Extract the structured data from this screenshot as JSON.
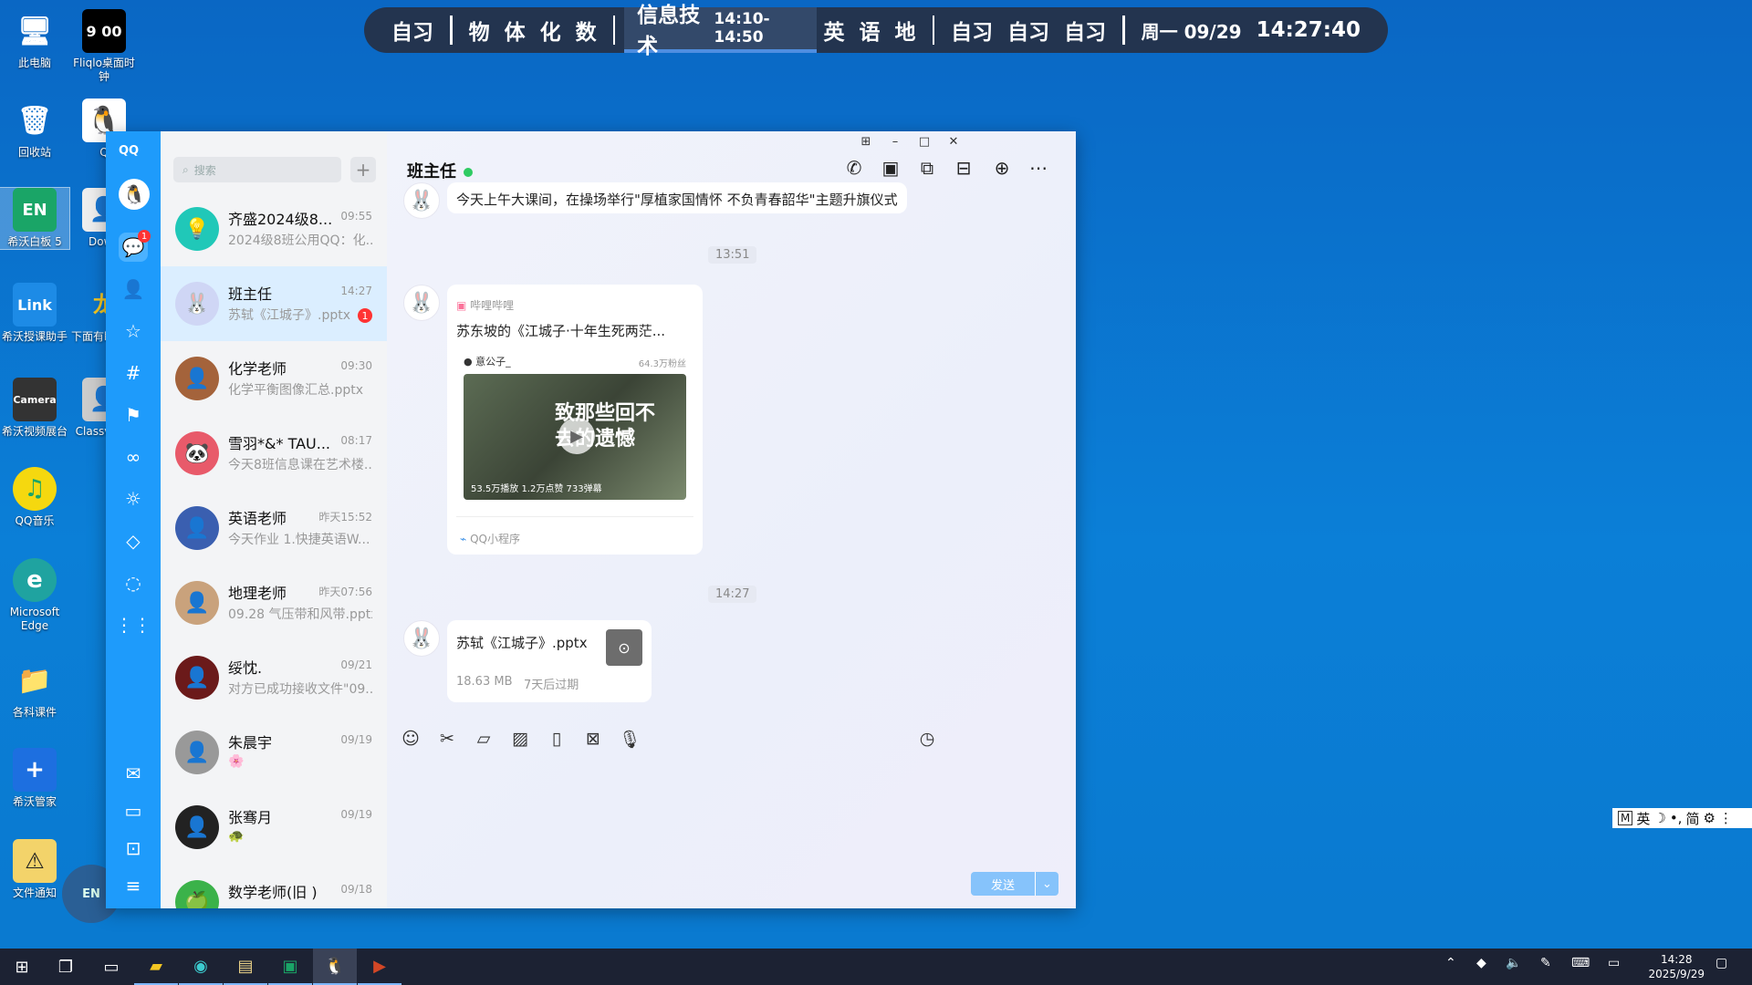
{
  "desktop": {
    "icons": [
      {
        "label": "此电脑",
        "glyph": "🖥"
      },
      {
        "label": "Fliqlo桌面时钟",
        "glyph": "9 00"
      },
      {
        "label": "回收站",
        "glyph": "🗑"
      },
      {
        "label": "Q",
        "glyph": "🐧"
      },
      {
        "label": "希沃白板 5",
        "glyph": "EN"
      },
      {
        "label": "Down",
        "glyph": "👤"
      },
      {
        "label": "希沃授课助手",
        "glyph": "Link"
      },
      {
        "label": "下面有盯着你",
        "glyph": "龙"
      },
      {
        "label": "希沃视频展台",
        "glyph": "Camera"
      },
      {
        "label": "Classv作业",
        "glyph": "👤"
      },
      {
        "label": "QQ音乐",
        "glyph": "♫"
      },
      {
        "label": "Microsoft Edge",
        "glyph": "e"
      },
      {
        "label": "各科课件",
        "glyph": "📁"
      },
      {
        "label": "希沃管家",
        "glyph": "+"
      },
      {
        "label": "文件通知",
        "glyph": "⚠"
      }
    ]
  },
  "schedule": {
    "items": [
      "自习",
      "物",
      "体",
      "化",
      "数",
      "英",
      "语",
      "地",
      "自习",
      "自习",
      "自习"
    ],
    "current": "信息技术",
    "current_time": "14:10-14:50",
    "date": "周一 09/29",
    "clock": "14:27:40"
  },
  "qq": {
    "logo": "QQ",
    "rail_badge": "1",
    "search_placeholder": "搜索",
    "conversations": [
      {
        "name": "齐盛2024级8...",
        "time": "09:55",
        "preview": "2024级8班公用QQ：化...",
        "color": "#20c8b8",
        "glyph": "💡"
      },
      {
        "name": "班主任",
        "time": "14:27",
        "preview": "苏轼《江城子》.pptx",
        "unread": "1",
        "color": "#cfd6f5",
        "glyph": "🐰"
      },
      {
        "name": "化学老师",
        "time": "09:30",
        "preview": "化学平衡图像汇总.pptx",
        "color": "#a4633b",
        "glyph": "👤"
      },
      {
        "name": "雪羽*&* TAU...",
        "time": "08:17",
        "preview": "今天8班信息课在艺术楼...",
        "color": "#e85a6a",
        "glyph": "🐼"
      },
      {
        "name": "英语老师",
        "time": "昨天15:52",
        "preview": "今天作业 1.快捷英语W...",
        "color": "#3a5fb0",
        "glyph": "👤"
      },
      {
        "name": "地理老师",
        "time": "昨天07:56",
        "preview": "09.28 气压带和风带.pptx",
        "color": "#c9a27c",
        "glyph": "👤"
      },
      {
        "name": "绥忱.",
        "time": "09/21",
        "preview": "对方已成功接收文件\"09...",
        "color": "#6b1a1a",
        "glyph": "👤"
      },
      {
        "name": "朱晨宇",
        "time": "09/19",
        "preview": "🌸",
        "color": "#999",
        "glyph": "👤"
      },
      {
        "name": "张骞月",
        "time": "09/19",
        "preview": "🐢",
        "color": "#222",
        "glyph": "👤"
      },
      {
        "name": "数学老师(旧 )",
        "time": "09/18",
        "preview": "",
        "color": "#3bb24a",
        "glyph": "🍏"
      }
    ],
    "chat": {
      "title": "班主任",
      "msg1": "今天上午大课间，在操场举行\"厚植家国情怀 不负青春韶华\"主题升旗仪式",
      "stamp1": "13:51",
      "card_source": "哔哩哔哩",
      "card_title": "苏东坡的《江城子·十年生死两茫...",
      "card_uploader": "意公子_",
      "card_fans": "64.3万粉丝",
      "card_stats": "53.5万播放  1.2万点赞  733弹幕",
      "card_overlay": "致那些回不去的遗憾",
      "card_app": "QQ小程序",
      "stamp2": "14:27",
      "file_name": "苏轼《江城子》.pptx",
      "file_size": "18.63 MB",
      "file_expire": "7天后过期",
      "send": "发送"
    }
  },
  "ime": {
    "items": [
      "M",
      "英",
      "☽",
      "•,",
      "简",
      "⚙",
      "⋮"
    ]
  },
  "taskbar": {
    "time": "14:28",
    "date": "2025/9/29"
  }
}
